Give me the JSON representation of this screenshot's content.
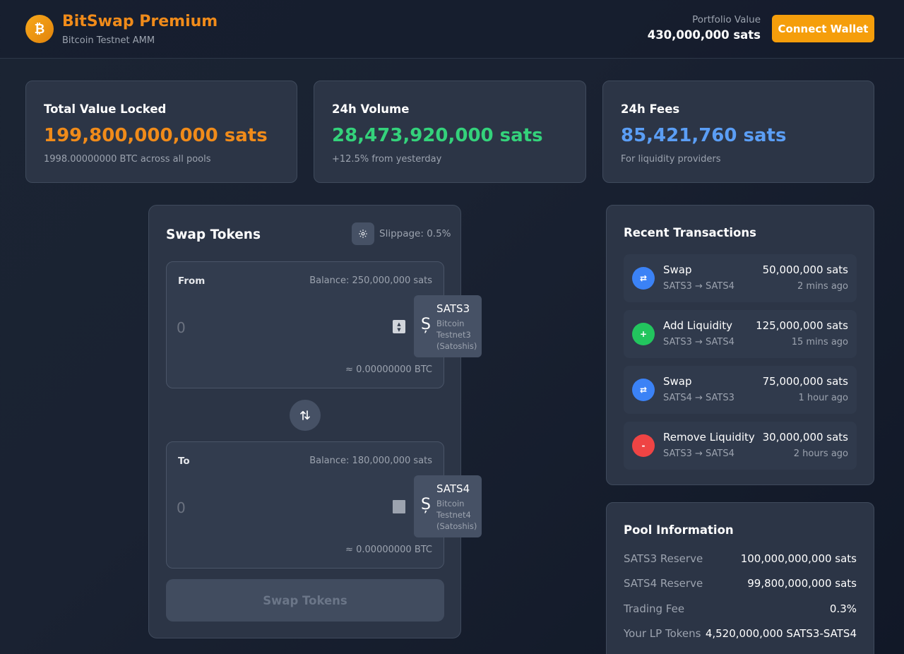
{
  "header": {
    "app_title": "BitSwap Premium",
    "subtitle": "Bitcoin Testnet AMM",
    "logo_glyph": "₿",
    "portfolio_label": "Portfolio Value",
    "portfolio_value": "430,000,000 sats",
    "connect_label": "Connect Wallet"
  },
  "stats": [
    {
      "title": "Total Value Locked",
      "value": "199,800,000,000 sats",
      "sub": "1998.00000000 BTC across all pools",
      "color": "#f08b1a"
    },
    {
      "title": "24h Volume",
      "value": "28,473,920,000 sats",
      "sub": "+12.5% from yesterday",
      "color": "#34d27b"
    },
    {
      "title": "24h Fees",
      "value": "85,421,760 sats",
      "sub": "For liquidity providers",
      "color": "#5b9ef5"
    }
  ],
  "swap": {
    "title": "Swap Tokens",
    "settings_icon": "gear-icon",
    "slippage": "Slippage: 0.5%",
    "flip_icon": "swap-vertical-icon",
    "submit_label": "Swap Tokens",
    "from": {
      "label": "From",
      "balance": "Balance: 250,000,000 sats",
      "placeholder": "0",
      "btc_estimate": "≈ 0.00000000 BTC",
      "token_icon": "Ș",
      "token_symbol": "SATS3",
      "token_desc": "Bitcoin Testnet3 (Satoshis)"
    },
    "to": {
      "label": "To",
      "balance": "Balance: 180,000,000 sats",
      "placeholder": "0",
      "btc_estimate": "≈ 0.00000000 BTC",
      "token_icon": "Ș",
      "token_symbol": "SATS4",
      "token_desc": "Bitcoin Testnet4 (Satoshis)"
    }
  },
  "transactions": {
    "title": "Recent Transactions",
    "items": [
      {
        "type": "Swap",
        "pair": "SATS3 → SATS4",
        "amount": "50,000,000 sats",
        "time": "2 mins ago",
        "icon": "⇄",
        "icon_name": "swap-icon",
        "color": "#3b82f6"
      },
      {
        "type": "Add Liquidity",
        "pair": "SATS3 → SATS4",
        "amount": "125,000,000 sats",
        "time": "15 mins ago",
        "icon": "+",
        "icon_name": "plus-icon",
        "color": "#22c55e"
      },
      {
        "type": "Swap",
        "pair": "SATS4 → SATS3",
        "amount": "75,000,000 sats",
        "time": "1 hour ago",
        "icon": "⇄",
        "icon_name": "swap-icon",
        "color": "#3b82f6"
      },
      {
        "type": "Remove Liquidity",
        "pair": "SATS3 → SATS4",
        "amount": "30,000,000 sats",
        "time": "2 hours ago",
        "icon": "-",
        "icon_name": "minus-icon",
        "color": "#ef4444"
      }
    ]
  },
  "pool": {
    "title": "Pool Information",
    "rows": [
      {
        "label": "SATS3 Reserve",
        "value": "100,000,000,000 sats"
      },
      {
        "label": "SATS4 Reserve",
        "value": "99,800,000,000 sats"
      },
      {
        "label": "Trading Fee",
        "value": "0.3%"
      },
      {
        "label": "Your LP Tokens",
        "value": "4,520,000,000 SATS3-SATS4"
      }
    ]
  }
}
